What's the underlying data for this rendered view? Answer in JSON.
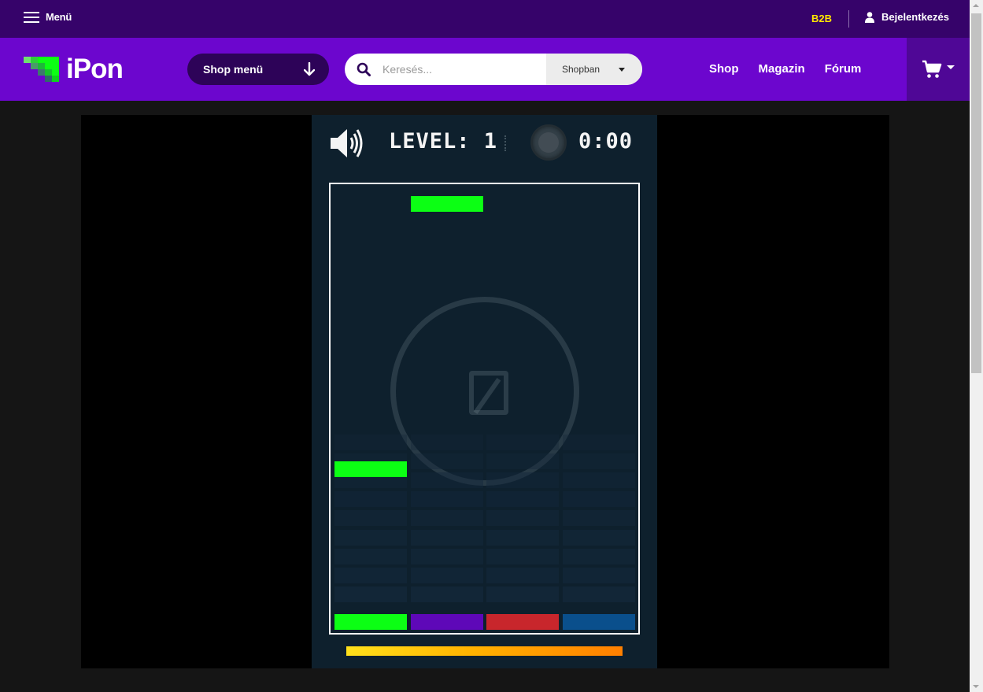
{
  "topbar": {
    "menu_label": "Menü",
    "b2b_label": "B2B",
    "login_label": "Bejelentkezés"
  },
  "header": {
    "logo_text": "iPon",
    "shop_menu_label": "Shop menü",
    "search": {
      "placeholder": "Keresés...",
      "value": "",
      "scope_label": "Shopban"
    },
    "nav": [
      {
        "label": "Shop"
      },
      {
        "label": "Magazin"
      },
      {
        "label": "Fórum"
      }
    ]
  },
  "colors": {
    "topbar_bg": "#36036a",
    "header_bg": "#6c06ce",
    "b2b": "#ffe500",
    "lane_colors": [
      "#0cff14",
      "#5e08b8",
      "#c8262c",
      "#0a4f8c"
    ]
  },
  "game": {
    "level_label": "LEVEL: 1",
    "timer": "0:00",
    "sound_state": "on",
    "lanes": 4,
    "rows": 12,
    "falling_blocks": [
      {
        "lane": 1,
        "row": 0,
        "color": "#0cff14"
      },
      {
        "lane": 0,
        "row": 14,
        "color": "#0cff14"
      }
    ],
    "targets": [
      {
        "lane": 0,
        "color": "#0cff14"
      },
      {
        "lane": 1,
        "color": "#5e08b8"
      },
      {
        "lane": 2,
        "color": "#c8262c"
      },
      {
        "lane": 3,
        "color": "#0a4f8c"
      }
    ],
    "time_remaining_fraction": 1.0
  }
}
